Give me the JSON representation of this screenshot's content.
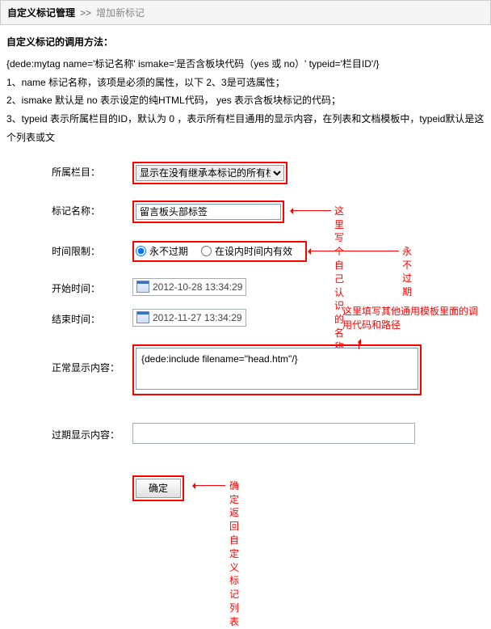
{
  "header": {
    "title": "自定义标记管理",
    "separator": ">>",
    "action": "增加新标记"
  },
  "usage": {
    "title": "自定义标记的调用方法：",
    "code": "{dede:mytag name='标记名称' ismake='是否含板块代码（yes 或 no）' typeid='栏目ID'/}",
    "line1": "1、name 标记名称，该项是必须的属性，以下 2、3是可选属性；",
    "line2": "2、ismake 默认是 no 表示设定的纯HTML代码， yes 表示含板块标记的代码；",
    "line3": "3、typeid 表示所属栏目的ID，默认为 0 ，表示所有栏目通用的显示内容，在列表和文档模板中，typeid默认是这个列表或文"
  },
  "form": {
    "category": {
      "label": "所属栏目：",
      "selected": "显示在没有继承本标记的所有栏目"
    },
    "tagName": {
      "label": "标记名称：",
      "value": "留言板头部标签"
    },
    "timeLimit": {
      "label": "时间限制：",
      "option1": "永不过期",
      "option2": "在设内时间内有效"
    },
    "startTime": {
      "label": "开始时间：",
      "value": "2012-10-28 13:34:29"
    },
    "endTime": {
      "label": "结束时间：",
      "value": "2012-11-27 13:34:29"
    },
    "normalContent": {
      "label": "正常显示内容：",
      "value": "{dede:include filename=\"head.htm\"/}"
    },
    "expiredContent": {
      "label": "过期显示内容：",
      "value": ""
    },
    "submit": "确定"
  },
  "annotations": {
    "tagName": "这里写个自己认识的名称",
    "timeLimit": "永不过期",
    "normalContent": "这里填写其他通用模板里面的调用代码和路径",
    "submit": "确定返回自定义标记列表"
  }
}
